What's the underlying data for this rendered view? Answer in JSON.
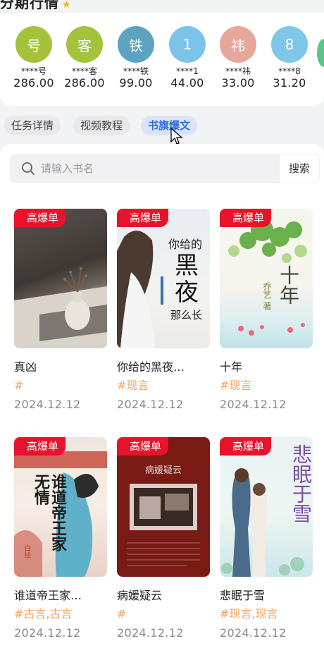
{
  "header": {
    "title": "分期行情"
  },
  "ranking": [
    {
      "avatar_char": "号",
      "color": "#a5c23c",
      "name": "****号",
      "amount": "286.00"
    },
    {
      "avatar_char": "客",
      "color": "#a5c23c",
      "name": "****客",
      "amount": "286.00"
    },
    {
      "avatar_char": "铁",
      "color": "#5ca3c2",
      "name": "****铁",
      "amount": "99.00"
    },
    {
      "avatar_char": "1",
      "color": "#7cc3ea",
      "name": "****1",
      "amount": "44.00"
    },
    {
      "avatar_char": "祎",
      "color": "#e8a79b",
      "name": "****祎",
      "amount": "33.00"
    },
    {
      "avatar_char": "8",
      "color": "#7fc7e6",
      "name": "****8",
      "amount": "31.20"
    }
  ],
  "tabs": [
    {
      "label": "任务详情",
      "active": false
    },
    {
      "label": "视频教程",
      "active": false
    },
    {
      "label": "书旗爆文",
      "active": true
    }
  ],
  "search": {
    "placeholder": "请输入书名",
    "button_label": "搜索"
  },
  "books": [
    {
      "badge": "高爆单",
      "title": "真凶",
      "tags": "#",
      "date": "2024.12.12"
    },
    {
      "badge": "高爆单",
      "title": "你给的黑夜…",
      "tags": "#现言",
      "date": "2024.12.12"
    },
    {
      "badge": "高爆单",
      "title": "十年",
      "tags": "#现言",
      "date": "2024.12.12"
    },
    {
      "badge": "高爆单",
      "title": "谁道帝王家…",
      "tags": "#古言,古言",
      "date": "2024.12.12"
    },
    {
      "badge": "高爆单",
      "title": "病媛疑云",
      "tags": "#",
      "date": "2024.12.12"
    },
    {
      "badge": "高爆单",
      "title": "悲眠于雪",
      "tags": "#现言,现言",
      "date": "2024.12.12"
    }
  ],
  "covers": {
    "cover2": {
      "title_lines": [
        "你给的",
        "黑",
        "夜",
        "那么长"
      ]
    },
    "cover3": {
      "title": "十年",
      "author": "乔艺 著"
    },
    "cover4": {
      "title": "谁道帝王家无情",
      "author": "白绘"
    },
    "cover5": {
      "title": "病媛疑云"
    },
    "cover6": {
      "title": "悲眠于雪"
    }
  },
  "colors": {
    "accent": "#2f6de1",
    "badge": "#e8132a",
    "tag": "#f2a15a"
  }
}
